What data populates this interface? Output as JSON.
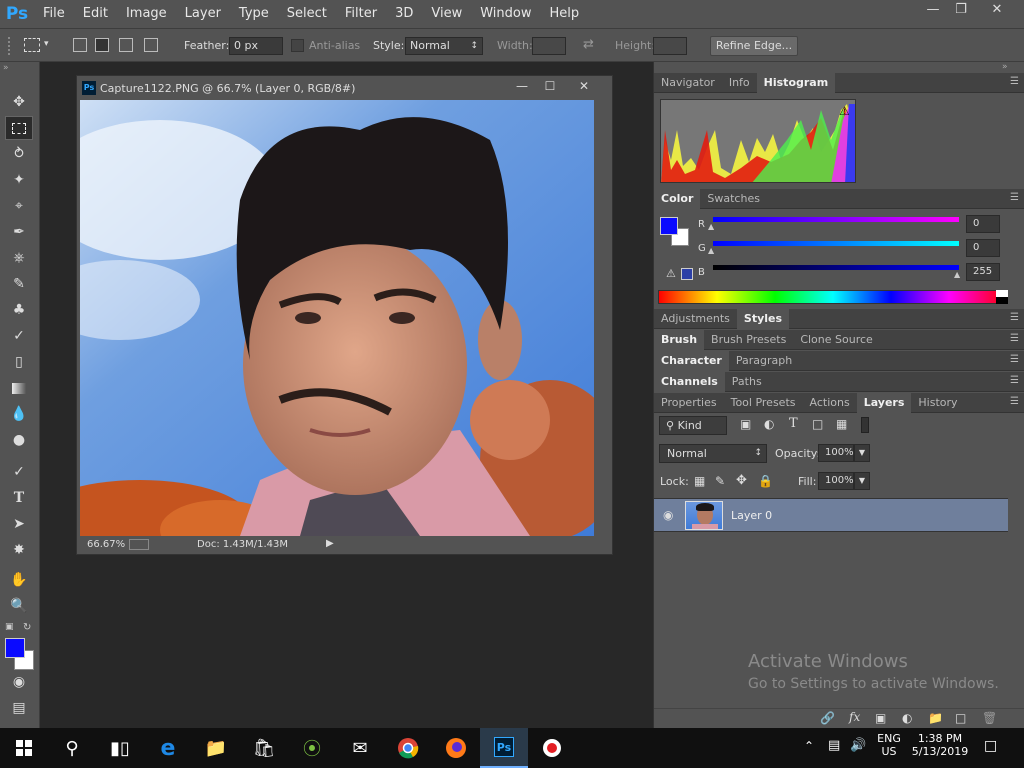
{
  "app": {
    "logo": "Ps",
    "menu": [
      "File",
      "Edit",
      "Image",
      "Layer",
      "Type",
      "Select",
      "Filter",
      "3D",
      "View",
      "Window",
      "Help"
    ]
  },
  "options": {
    "feather_label": "Feather:",
    "feather_value": "0 px",
    "antialias_label": "Anti-alias",
    "style_label": "Style:",
    "style_value": "Normal",
    "width_label": "Width:",
    "height_label": "Height:",
    "refine_edge": "Refine Edge..."
  },
  "document": {
    "title": "Capture1122.PNG @ 66.7% (Layer 0, RGB/8#)",
    "zoom": "66.67%",
    "doc_info": "Doc: 1.43M/1.43M"
  },
  "panels": {
    "nav_tabs": [
      "Navigator",
      "Info",
      "Histogram"
    ],
    "color_tabs": [
      "Color",
      "Swatches"
    ],
    "color": {
      "r_label": "R",
      "g_label": "G",
      "b_label": "B",
      "r": "0",
      "g": "0",
      "b": "255",
      "fg": "#0a0aff",
      "bg": "#ffffff"
    },
    "adj_tabs": [
      "Adjustments",
      "Styles"
    ],
    "brush_tabs": [
      "Brush",
      "Brush Presets",
      "Clone Source"
    ],
    "char_tabs": [
      "Character",
      "Paragraph"
    ],
    "channel_tabs": [
      "Channels",
      "Paths"
    ],
    "layer_tabs": [
      "Properties",
      "Tool Presets",
      "Actions",
      "Layers",
      "History"
    ],
    "layers": {
      "kind": "Kind",
      "blend_mode": "Normal",
      "opacity_label": "Opacity:",
      "opacity": "100%",
      "lock_label": "Lock:",
      "fill_label": "Fill:",
      "fill": "100%",
      "items": [
        {
          "name": "Layer 0"
        }
      ]
    }
  },
  "watermark": {
    "title": "Activate Windows",
    "subtitle": "Go to Settings to activate Windows."
  },
  "taskbar": {
    "lang1": "ENG",
    "lang2": "US",
    "time": "1:38 PM",
    "date": "5/13/2019"
  }
}
